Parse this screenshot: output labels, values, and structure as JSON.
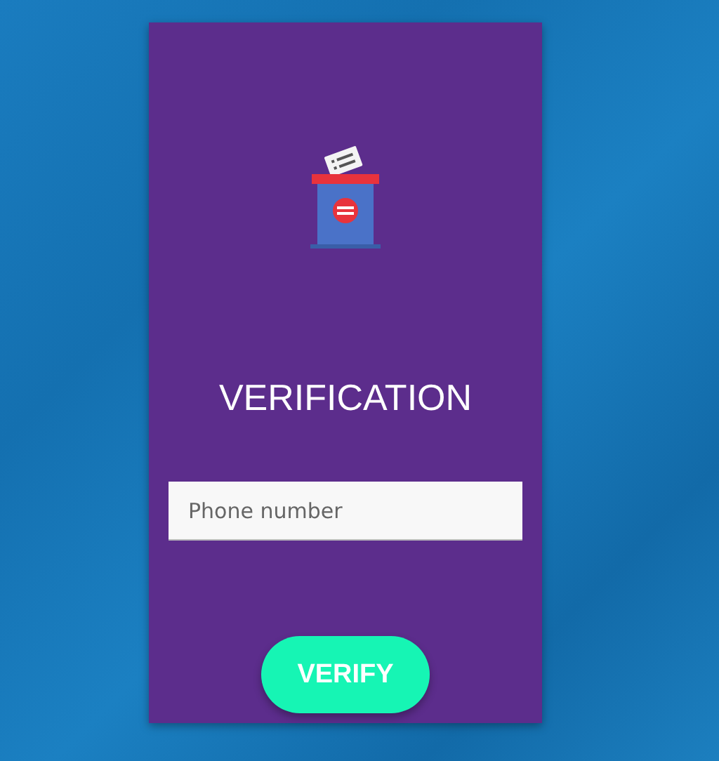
{
  "title": "VERIFICATION",
  "phone_field": {
    "placeholder": "Phone number"
  },
  "button": {
    "label": "VERIFY"
  }
}
